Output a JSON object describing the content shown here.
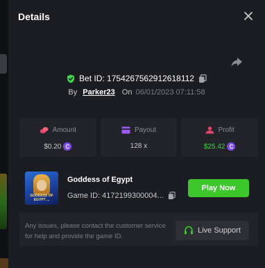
{
  "dialog": {
    "title": "Details"
  },
  "bet": {
    "bet_id_text": "Bet ID: 1754267562912618112",
    "by_label": "By",
    "user": "Parker23",
    "on_label": "On",
    "date": "06/01/2023 07:11:58"
  },
  "stats": {
    "amount": {
      "label": "Amount",
      "value": "$0.20",
      "icon_color": "#e8436a"
    },
    "payout": {
      "label": "Payout",
      "value": "128 x",
      "icon_color": "#9b59f5"
    },
    "profit": {
      "label": "Profit",
      "value": "$25.42",
      "icon_color": "#e8436a",
      "value_color": "#3dd44a"
    }
  },
  "game": {
    "name": "Goddess of Egypt",
    "thumb_label": "GODDESS OF EGYPT ...",
    "game_id_text": "Game ID: 4172199300004...",
    "play_label": "Play Now"
  },
  "support": {
    "text": "Any issues, please contact the customer service for help and provide the game ID.",
    "button_label": "Live Support"
  },
  "colors": {
    "accent_green": "#3cc72b",
    "shield_green": "#3dd44a",
    "coin_purple": "#7a4cf0"
  },
  "icons": {
    "close": "close-icon",
    "share": "share-icon",
    "shield": "shield-check-icon",
    "copy": "copy-icon",
    "coin": "coin-icon",
    "headset": "headset-icon"
  }
}
